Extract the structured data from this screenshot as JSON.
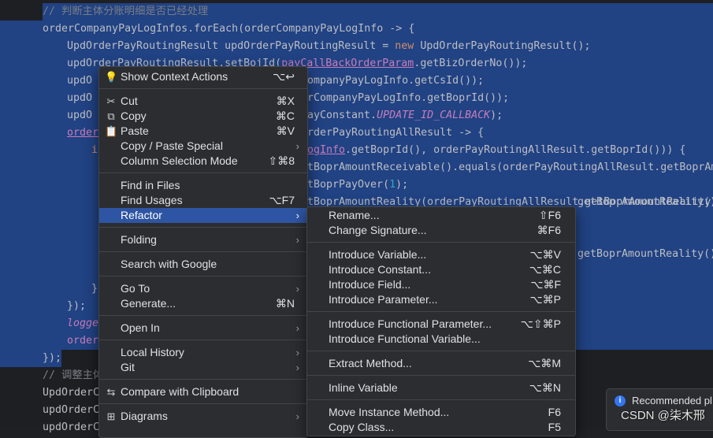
{
  "code_lines": [
    {
      "indent": 54,
      "selected": true,
      "parts": [
        {
          "t": "// 判断主体分账明细是否已经处理",
          "c": "c-comment"
        }
      ]
    },
    {
      "indent": 54,
      "selected": true,
      "parts": [
        {
          "t": "orderCompanyPayLogInfos.forEach(orderCompanyPayLogInfo -> {",
          "c": ""
        }
      ]
    },
    {
      "indent": 85,
      "selected": true,
      "parts": [
        {
          "t": "UpdOrderPayRoutingResult updOrderPayRoutingResult = ",
          "c": ""
        },
        {
          "t": "new",
          "c": "c-kw"
        },
        {
          "t": " UpdOrderPayRoutingResult();",
          "c": ""
        }
      ]
    },
    {
      "indent": 85,
      "selected": true,
      "parts": [
        {
          "t": "updOrderPayRoutingResult.setBojId(",
          "c": ""
        },
        {
          "t": "payCallBackOrderParam",
          "c": "c-field c-ul"
        },
        {
          "t": ".getBizOrderNo());",
          "c": ""
        }
      ]
    },
    {
      "indent": 85,
      "selected": true,
      "parts": [
        {
          "t": "updO",
          "c": ""
        }
      ]
    },
    {
      "indent": 85,
      "selected": true,
      "parts": [
        {
          "t": "updO",
          "c": ""
        }
      ]
    },
    {
      "indent": 85,
      "selected": true,
      "parts": [
        {
          "t": "updO",
          "c": ""
        }
      ]
    },
    {
      "indent": 85,
      "selected": true,
      "parts": [
        {
          "t": "order",
          "c": "c-field c-ul"
        }
      ]
    },
    {
      "indent": 116,
      "selected": true,
      "parts": [
        {
          "t": "i",
          "c": "c-kw"
        }
      ]
    },
    {
      "indent": 0,
      "selected": true,
      "parts": []
    },
    {
      "indent": 0,
      "selected": true,
      "parts": []
    },
    {
      "indent": 0,
      "selected": true,
      "parts": []
    },
    {
      "indent": 0,
      "selected": true,
      "parts": []
    },
    {
      "indent": 0,
      "selected": true,
      "parts": []
    },
    {
      "indent": 0,
      "selected": true,
      "parts": []
    },
    {
      "indent": 0,
      "selected": true,
      "parts": []
    },
    {
      "indent": 116,
      "selected": true,
      "parts": [
        {
          "t": "}",
          "c": ""
        }
      ]
    },
    {
      "indent": 85,
      "selected": true,
      "parts": [
        {
          "t": "});",
          "c": ""
        }
      ]
    },
    {
      "indent": 85,
      "selected": true,
      "parts": [
        {
          "t": "logge",
          "c": "c-const"
        }
      ]
    },
    {
      "indent": 85,
      "selected": true,
      "parts": [
        {
          "t": "order",
          "c": "c-field"
        }
      ]
    },
    {
      "indent": 54,
      "selected": true,
      "parts": [
        {
          "t": "});",
          "c": ""
        }
      ]
    },
    {
      "indent": 54,
      "selected": false,
      "parts": [
        {
          "t": "// 调整主体",
          "c": "c-comment"
        }
      ]
    },
    {
      "indent": 54,
      "selected": false,
      "parts": [
        {
          "t": "UpdOrderC",
          "c": ""
        }
      ]
    },
    {
      "indent": 54,
      "selected": false,
      "parts": [
        {
          "t": "updOrderC",
          "c": ""
        }
      ]
    },
    {
      "indent": 54,
      "selected": false,
      "parts": [
        {
          "t": "updOrderC",
          "c": ""
        }
      ]
    }
  ],
  "code_right": [
    {
      "line": 4,
      "parts": [
        {
          "t": "ompanyPayLogInfo.getCsId());",
          "c": ""
        }
      ]
    },
    {
      "line": 5,
      "parts": [
        {
          "t": "rCompanyPayLogInfo.getBoprId());",
          "c": ""
        }
      ]
    },
    {
      "line": 6,
      "parts": [
        {
          "t": "ayConstant.",
          "c": ""
        },
        {
          "t": "UPDATE_ID_CALLBACK",
          "c": "c-const"
        },
        {
          "t": ");",
          "c": ""
        }
      ]
    },
    {
      "line": 7,
      "parts": [
        {
          "t": "rderPayRoutingAllResult -> {",
          "c": ""
        }
      ]
    },
    {
      "line": 8,
      "parts": [
        {
          "t": "ogInfo",
          "c": "c-field c-ul"
        },
        {
          "t": ".getBoprId(), orderPayRoutingAllResult.getBoprId())) {",
          "c": ""
        }
      ]
    },
    {
      "line": 9,
      "parts": [
        {
          "t": "tBoprAmountReceivable().equals(orderPayRoutingAllResult.getBoprAmo",
          "c": ""
        }
      ]
    },
    {
      "line": 10,
      "parts": [
        {
          "t": "tBoprPayOver(",
          "c": ""
        },
        {
          "t": "1",
          "c": "c-num"
        },
        {
          "t": ");",
          "c": ""
        }
      ]
    },
    {
      "line": 11,
      "parts": [
        {
          "t": "tBoprAmountReality(orderPayRoutingAllResult.getBoprAmountReality()",
          "c": ""
        }
      ]
    }
  ],
  "code_far_right": [
    {
      "line": 11,
      "parts": [
        {
          "t": "getBoprAmountReality()",
          "c": ""
        }
      ]
    },
    {
      "line": 14,
      "parts": [
        {
          "t": "getBoprAmountReality()",
          "c": ""
        }
      ]
    }
  ],
  "context_menu": {
    "items": [
      {
        "kind": "item",
        "label": "Show Context Actions",
        "shortcut": "⌥↩",
        "icon": "lightbulb-icon",
        "glyph": "💡"
      },
      {
        "kind": "sep"
      },
      {
        "kind": "item",
        "label": "Cut",
        "shortcut": "⌘X",
        "icon": "scissors-icon",
        "glyph": "✂"
      },
      {
        "kind": "item",
        "label": "Copy",
        "shortcut": "⌘C",
        "icon": "copy-icon",
        "glyph": "⧉"
      },
      {
        "kind": "item",
        "label": "Paste",
        "shortcut": "⌘V",
        "icon": "clipboard-icon",
        "glyph": "📋"
      },
      {
        "kind": "item",
        "label": "Copy / Paste Special",
        "submenu": true
      },
      {
        "kind": "item",
        "label": "Column Selection Mode",
        "shortcut": "⇧⌘8"
      },
      {
        "kind": "sep"
      },
      {
        "kind": "item",
        "label": "Find in Files"
      },
      {
        "kind": "item",
        "label": "Find Usages",
        "shortcut": "⌥F7"
      },
      {
        "kind": "item",
        "label": "Refactor",
        "submenu": true,
        "active": true
      },
      {
        "kind": "sep"
      },
      {
        "kind": "item",
        "label": "Folding",
        "submenu": true
      },
      {
        "kind": "sep"
      },
      {
        "kind": "item",
        "label": "Search with Google"
      },
      {
        "kind": "sep"
      },
      {
        "kind": "item",
        "label": "Go To",
        "submenu": true
      },
      {
        "kind": "item",
        "label": "Generate...",
        "shortcut": "⌘N"
      },
      {
        "kind": "sep"
      },
      {
        "kind": "item",
        "label": "Open In",
        "submenu": true
      },
      {
        "kind": "sep"
      },
      {
        "kind": "item",
        "label": "Local History",
        "submenu": true
      },
      {
        "kind": "item",
        "label": "Git",
        "submenu": true
      },
      {
        "kind": "sep"
      },
      {
        "kind": "item",
        "label": "Compare with Clipboard",
        "icon": "compare-icon",
        "glyph": "⇆"
      },
      {
        "kind": "sep"
      },
      {
        "kind": "item",
        "label": "Diagrams",
        "submenu": true,
        "icon": "diagram-icon",
        "glyph": "⊞"
      }
    ]
  },
  "refactor_menu": {
    "items": [
      {
        "kind": "item",
        "label": "Rename...",
        "shortcut": "⇧F6"
      },
      {
        "kind": "item",
        "label": "Change Signature...",
        "shortcut": "⌘F6"
      },
      {
        "kind": "sep"
      },
      {
        "kind": "item",
        "label": "Introduce Variable...",
        "shortcut": "⌥⌘V"
      },
      {
        "kind": "item",
        "label": "Introduce Constant...",
        "shortcut": "⌥⌘C"
      },
      {
        "kind": "item",
        "label": "Introduce Field...",
        "shortcut": "⌥⌘F"
      },
      {
        "kind": "item",
        "label": "Introduce Parameter...",
        "shortcut": "⌥⌘P"
      },
      {
        "kind": "sep"
      },
      {
        "kind": "item",
        "label": "Introduce Functional Parameter...",
        "shortcut": "⌥⇧⌘P"
      },
      {
        "kind": "item",
        "label": "Introduce Functional Variable..."
      },
      {
        "kind": "sep"
      },
      {
        "kind": "item",
        "label": "Extract Method...",
        "shortcut": "⌥⌘M"
      },
      {
        "kind": "sep"
      },
      {
        "kind": "item",
        "label": "Inline Variable",
        "shortcut": "⌥⌘N"
      },
      {
        "kind": "sep"
      },
      {
        "kind": "item",
        "label": "Move Instance Method...",
        "shortcut": "F6"
      },
      {
        "kind": "item",
        "label": "Copy Class...",
        "shortcut": "F5"
      }
    ]
  },
  "notification": {
    "label": "Recommended pl",
    "icon": "info-icon"
  },
  "watermark": {
    "text": "CSDN @柒木邢"
  },
  "colors": {
    "selection": "#214283",
    "menu_bg": "#2b2d30",
    "menu_active": "#2e55a3"
  }
}
